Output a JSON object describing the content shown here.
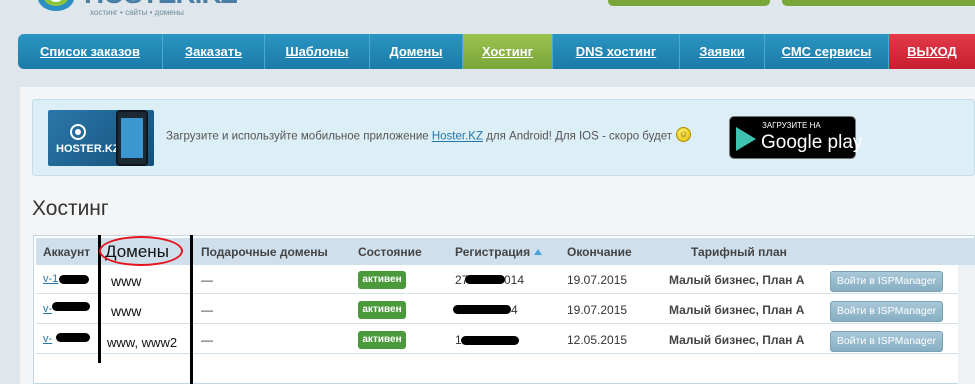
{
  "header": {
    "logo_text": "HOSTER.KZ",
    "logo_subtitle": "хостинг • сайты • домены"
  },
  "nav": {
    "items": [
      {
        "label": "Список заказов",
        "active": false
      },
      {
        "label": "Заказать",
        "active": false
      },
      {
        "label": "Шаблоны",
        "active": false
      },
      {
        "label": "Домены",
        "active": false
      },
      {
        "label": "Хостинг",
        "active": true
      },
      {
        "label": "DNS хостинг",
        "active": false
      },
      {
        "label": "Заявки",
        "active": false
      },
      {
        "label": "СМС сервисы",
        "active": false
      },
      {
        "label": "ВЫХОД",
        "active": false
      }
    ]
  },
  "banner": {
    "image_label": "HOSTER.KZ",
    "text_before": "Загрузите и используйте мобильное приложение ",
    "link_text": "Hoster.KZ",
    "text_after": " для Android! Для IOS - скоро будет",
    "store_small": "ЗАГРУЗИТЕ НА",
    "store_big": "Google play"
  },
  "page_title": "Хостинг",
  "table": {
    "headers": {
      "account": "Аккаунт",
      "domains": "Домены",
      "gift": "Подарочные домены",
      "state": "Состояние",
      "registration": "Регистрация",
      "expiry": "Окончание",
      "plan": "Тарифный план"
    },
    "rows": [
      {
        "account": "v-1",
        "domains": "www",
        "gift": "—",
        "state": "активен",
        "registration": "27",
        "registration_tail": "014",
        "expiry": "19.07.2015",
        "plan": "Малый бизнес, План А",
        "action": "Войти в ISPManager"
      },
      {
        "account": "v-",
        "domains": "www",
        "gift": "—",
        "state": "активен",
        "registration": "",
        "registration_tail": "4",
        "expiry": "19.07.2015",
        "plan": "Малый бизнес, План А",
        "action": "Войти в ISPManager"
      },
      {
        "account": "v-",
        "domains": "www, www2",
        "gift": "—",
        "state": "активен",
        "registration": "1",
        "registration_tail": "",
        "expiry": "12.05.2015",
        "plan": "Малый бизнес, План А",
        "action": "Войти в ISPManager"
      }
    ]
  },
  "colors": {
    "nav_blue": "#1a7ba9",
    "nav_active_green": "#7aa63a",
    "exit_red": "#c71f30",
    "status_green": "#4a9a3c",
    "annotation_red": "#e4151f"
  },
  "icons": [
    "logo-icon",
    "sort-up-icon",
    "smiley-icon",
    "google-play-icon",
    "android-phone-icon"
  ]
}
